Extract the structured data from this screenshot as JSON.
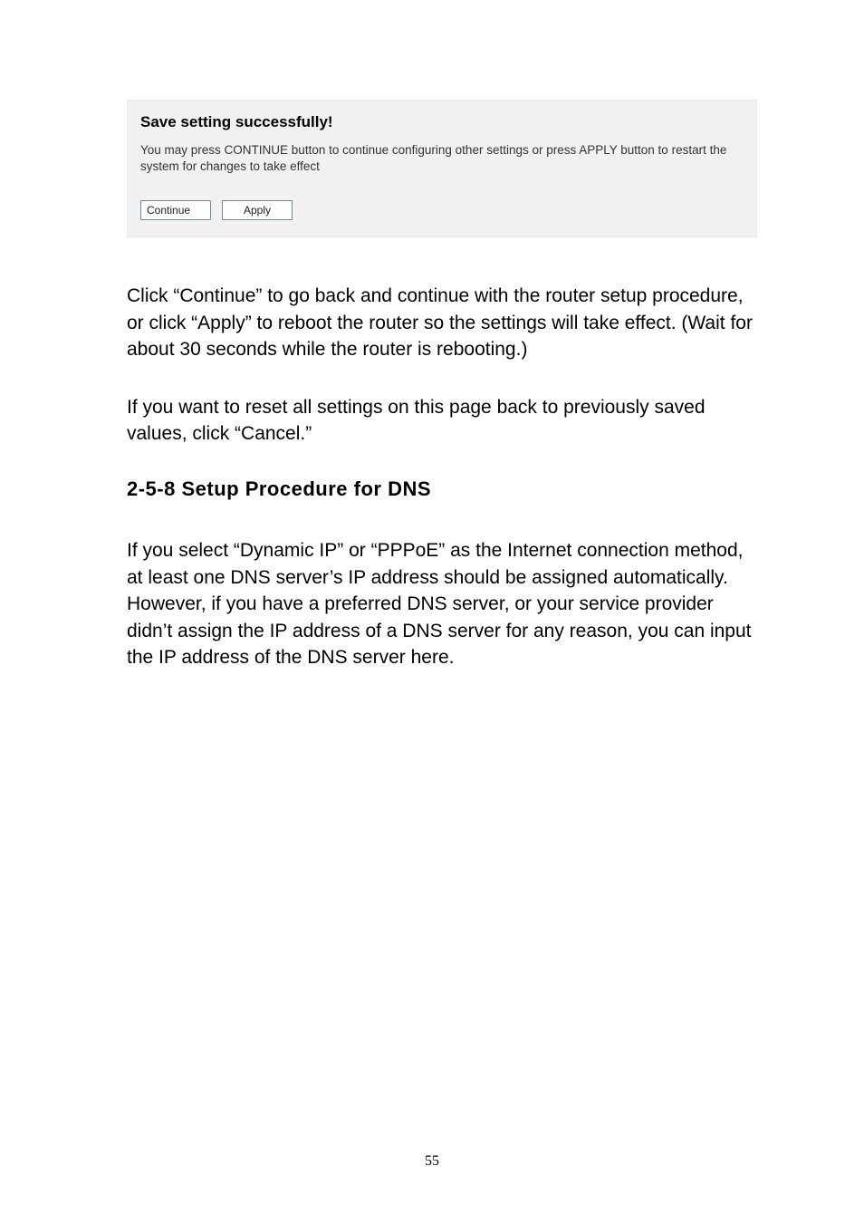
{
  "panel": {
    "title": "Save setting successfully!",
    "description": "You may press CONTINUE button to continue configuring other settings or press APPLY button to restart the system for changes to take effect",
    "continue_label": "Continue",
    "apply_label": "Apply"
  },
  "paragraphs": {
    "p1": "Click “Continue” to go back and continue with the router setup procedure, or click “Apply” to reboot the router so the settings will take effect. (Wait for about 30 seconds while the router is rebooting.)",
    "p2": "If you want to reset all settings on this page back to previously saved values, click “Cancel.”"
  },
  "section_heading": "2-5-8 Setup Procedure for DNS",
  "section_body": "If you select “Dynamic IP” or “PPPoE” as the Internet connection method, at least one DNS server’s IP address should be assigned automatically. However, if you have a preferred DNS server, or your service provider didn’t assign the IP address of a DNS server for any reason, you can input the IP address of the DNS server here.",
  "page_number": "55"
}
